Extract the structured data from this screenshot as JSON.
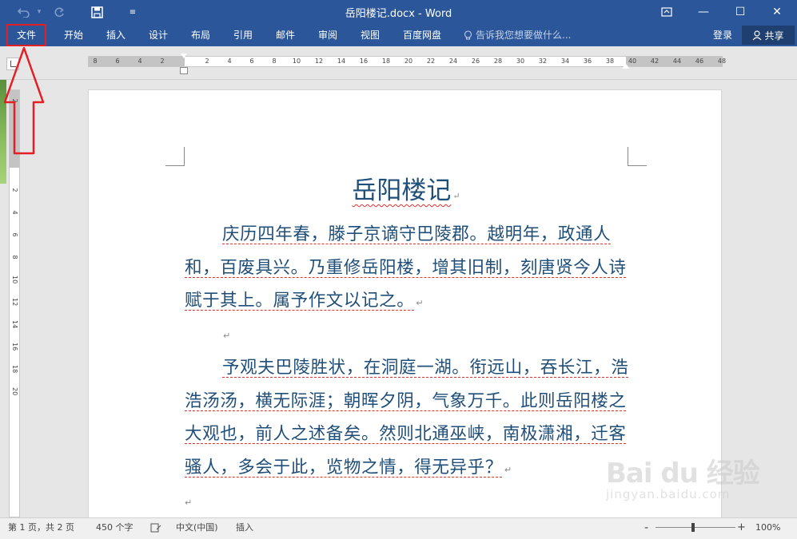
{
  "titlebar": {
    "title": "岳阳楼记.docx - Word",
    "undo_icon": "undo-icon",
    "redo_icon": "redo-icon",
    "save_icon": "save-icon",
    "customize_icon": "chevron-down-icon",
    "ribbon_display_icon": "ribbon-display-icon",
    "minimize_glyph": "—",
    "maximize_glyph": "☐",
    "close_glyph": "✕"
  },
  "ribbon": {
    "tabs": [
      "文件",
      "开始",
      "插入",
      "设计",
      "布局",
      "引用",
      "邮件",
      "审阅",
      "视图",
      "百度网盘"
    ],
    "tellme": "告诉我您想要做什么...",
    "login": "登录",
    "share": "共享"
  },
  "ruler": {
    "ticks": [
      "8",
      "6",
      "4",
      "2",
      "2",
      "4",
      "6",
      "8",
      "10",
      "12",
      "14",
      "16",
      "18",
      "20",
      "22",
      "24",
      "26",
      "28",
      "30",
      "32",
      "34",
      "36",
      "38",
      "40",
      "42",
      "44",
      "46",
      "48"
    ],
    "vticks": [
      "4",
      "2",
      "2",
      "4",
      "6",
      "8",
      "10",
      "12",
      "14",
      "16",
      "18",
      "20"
    ]
  },
  "document": {
    "title": "岳阳楼记",
    "paragraphs": [
      "庆历四年春，滕子京谪守巴陵郡。越明年，政通人和，百废具兴。乃重修岳阳楼，增其旧制，刻唐贤今人诗赋于其上。属予作文以记之。",
      "予观夫巴陵胜状，在洞庭一湖。衔远山，吞长江，浩浩汤汤，横无际涯；朝晖夕阴，气象万千。此则岳阳楼之大观也，前人之述备矣。然则北通巫峡，南极潇湘，迁客骚人，多会于此，览物之情，得无异乎？"
    ],
    "mark": "↵"
  },
  "watermark": {
    "logo": "Bai du 经验",
    "url": "jingyan.baidu.com"
  },
  "statusbar": {
    "page": "第 1 页，共 2 页",
    "words": "450 个字",
    "language": "中文(中国)",
    "mode": "插入",
    "zoom_minus": "-",
    "zoom_plus": "+",
    "zoom": "100%"
  },
  "colors": {
    "accent": "#2b579a",
    "annotation": "#e31e24",
    "text": "#1f4e79"
  }
}
